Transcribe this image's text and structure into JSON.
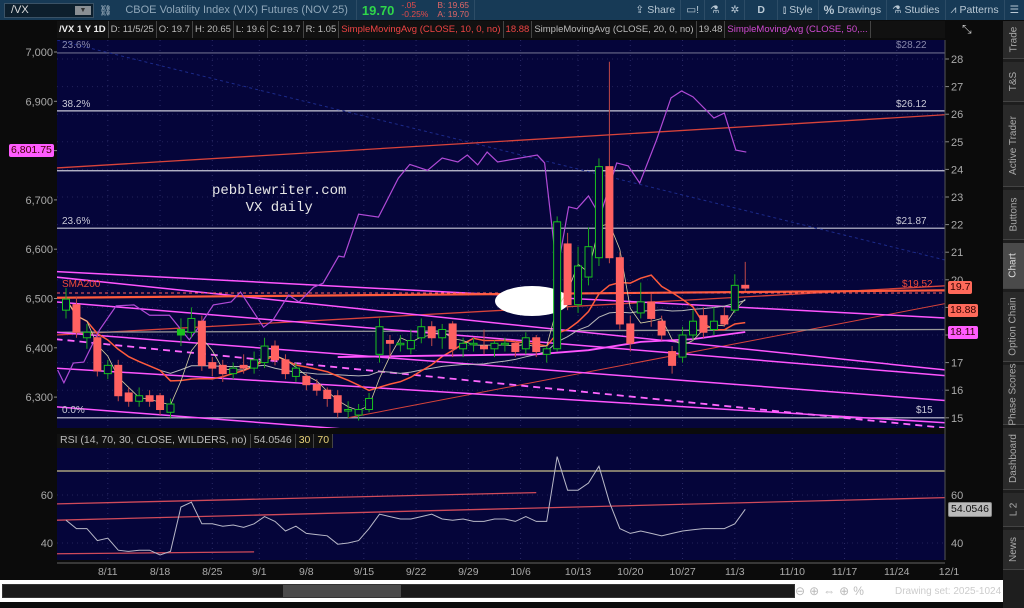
{
  "toolbar": {
    "symbol": "/VX",
    "description": "CBOE Volatility Index (VIX) Futures (NOV 25)",
    "last": "19.70",
    "change": "-.05",
    "change_pct": "-0.25%",
    "bid": "B: 19.65",
    "ask": "A: 19.70",
    "share": "Share",
    "timeframe": "D",
    "style": "Style",
    "drawings": "Drawings",
    "studies": "Studies",
    "patterns": "Patterns"
  },
  "header": {
    "symbol": "/VX 1 Y 1D",
    "date": "D: 11/5/25",
    "open": "O: 19.7",
    "high": "H: 20.65",
    "low": "L: 19.6",
    "close": "C: 19.7",
    "range": "R: 1.05",
    "sma10_label": "SimpleMovingAvg (CLOSE, 10, 0, no)",
    "sma10_value": "18.88",
    "sma20_label": "SimpleMovingAvg (CLOSE, 20, 0, no)",
    "sma20_value": "19.48",
    "sma50_label": "SimpleMovingAvg (CLOSE, 50,..."
  },
  "side_tabs": [
    "Trade",
    "T&S",
    "Active Trader",
    "Buttons",
    "Chart",
    "Option Chain",
    "Phase Scores",
    "Dashboard",
    "L 2",
    "News"
  ],
  "watermark": {
    "line1": "pebblewriter.com",
    "line2": "VX daily"
  },
  "annotations": {
    "fib_top_pct": "23.6%",
    "fib_top_price": "$28.22",
    "fib_382_pct": "38.2%",
    "fib_382_price": "$26.12",
    "fib_236_pct": "23.6%",
    "fib_236_price": "$21.87",
    "fib_0_pct": "0.0%",
    "fib_0_price": "$15",
    "sma200_label": "SMA200",
    "sma200_price": "$19.52"
  },
  "price_tags": {
    "last": "19.7",
    "sma10": "18.88",
    "sma50": "18.11",
    "overlay": "6,801.75",
    "rsi": "54.0546"
  },
  "rsi_header": {
    "label": "RSI (14, 70, 30, CLOSE, WILDERS, no)",
    "value": "54.0546",
    "os": "30",
    "ob": "70"
  },
  "bottom": {
    "drawing_set": "Drawing set: 2025-1024"
  },
  "colors": {
    "up": "#19c21f",
    "down": "#ff6161",
    "sma10": "#ff5a3c",
    "sma20": "#b8b8b8",
    "sma50": "#ff55ff",
    "overlay": "#b04ad6",
    "bg": "#05053a"
  },
  "chart_data": {
    "type": "candlestick",
    "title": "/VX 1 Y 1D",
    "right_axis_ticks": [
      "15",
      "16",
      "17",
      "18",
      "19",
      "20",
      "21",
      "22",
      "23",
      "24",
      "25",
      "26",
      "27",
      "28"
    ],
    "left_axis_ticks": [
      "6,300",
      "6,400",
      "6,500",
      "6,600",
      "6,700",
      "6,800",
      "6,900",
      "7,000"
    ],
    "rsi_ticks": [
      "40",
      "60"
    ],
    "x_labels": [
      {
        "label": "8/11",
        "day": 4
      },
      {
        "label": "8/18",
        "day": 9
      },
      {
        "label": "8/25",
        "day": 14
      },
      {
        "label": "9/1",
        "day": 18.5
      },
      {
        "label": "9/8",
        "day": 23
      },
      {
        "label": "9/15",
        "day": 28.5
      },
      {
        "label": "9/22",
        "day": 33.5
      },
      {
        "label": "9/29",
        "day": 38.5
      },
      {
        "label": "10/6",
        "day": 43.5
      },
      {
        "label": "10/13",
        "day": 49
      },
      {
        "label": "10/20",
        "day": 54
      },
      {
        "label": "10/27",
        "day": 59
      },
      {
        "label": "11/3",
        "day": 64
      },
      {
        "label": "11/10",
        "day": 69.5
      },
      {
        "label": "11/17",
        "day": 74.5
      },
      {
        "label": "11/24",
        "day": 79.5
      },
      {
        "label": "12/1",
        "day": 84.5
      }
    ],
    "ohlc": [
      [
        18.9,
        19.7,
        18.6,
        19.3
      ],
      [
        19.1,
        19.4,
        17.9,
        18.1
      ],
      [
        17.9,
        18.4,
        17.5,
        18.1
      ],
      [
        17.9,
        18.0,
        16.5,
        16.7
      ],
      [
        16.6,
        17.1,
        16.4,
        16.9
      ],
      [
        16.9,
        17.1,
        15.6,
        15.8
      ],
      [
        15.9,
        16.1,
        15.4,
        15.6
      ],
      [
        15.6,
        16.1,
        15.4,
        15.8
      ],
      [
        15.8,
        16.0,
        15.4,
        15.6
      ],
      [
        15.8,
        15.9,
        15.1,
        15.3
      ],
      [
        15.2,
        15.7,
        15.0,
        15.5
      ],
      [
        18.0,
        18.6,
        17.6,
        18.2
      ],
      [
        18.1,
        19.0,
        17.9,
        18.6
      ],
      [
        18.5,
        18.7,
        16.7,
        16.9
      ],
      [
        17.0,
        17.2,
        16.5,
        16.8
      ],
      [
        16.9,
        17.1,
        16.3,
        16.6
      ],
      [
        16.6,
        17.0,
        16.4,
        16.8
      ],
      [
        16.9,
        17.3,
        16.6,
        16.8
      ],
      [
        16.8,
        17.4,
        16.6,
        17.1
      ],
      [
        17.0,
        17.9,
        16.8,
        17.6
      ],
      [
        17.6,
        17.8,
        16.9,
        17.1
      ],
      [
        17.1,
        17.3,
        16.4,
        16.6
      ],
      [
        16.5,
        17.0,
        16.3,
        16.8
      ],
      [
        16.5,
        16.6,
        16.0,
        16.2
      ],
      [
        16.2,
        16.4,
        15.8,
        16.0
      ],
      [
        16.0,
        16.1,
        15.4,
        15.7
      ],
      [
        15.8,
        16.0,
        15.0,
        15.2
      ],
      [
        15.3,
        15.6,
        15.0,
        15.3
      ],
      [
        15.1,
        15.5,
        14.9,
        15.3
      ],
      [
        15.3,
        15.9,
        15.2,
        15.7
      ],
      [
        17.3,
        18.6,
        17.0,
        18.3
      ],
      [
        17.8,
        18.0,
        17.2,
        17.7
      ],
      [
        17.7,
        18.0,
        17.4,
        17.7
      ],
      [
        17.5,
        18.2,
        17.3,
        17.8
      ],
      [
        17.9,
        18.6,
        17.7,
        18.3
      ],
      [
        18.3,
        18.5,
        17.6,
        17.9
      ],
      [
        17.9,
        18.4,
        17.5,
        18.2
      ],
      [
        18.4,
        18.5,
        17.2,
        17.5
      ],
      [
        17.5,
        17.9,
        17.2,
        17.7
      ],
      [
        17.7,
        17.9,
        17.4,
        17.7
      ],
      [
        17.6,
        18.2,
        17.3,
        17.5
      ],
      [
        17.5,
        17.8,
        17.2,
        17.7
      ],
      [
        17.7,
        17.9,
        17.4,
        17.7
      ],
      [
        17.7,
        17.8,
        17.2,
        17.4
      ],
      [
        17.5,
        18.1,
        17.3,
        17.9
      ],
      [
        17.9,
        18.0,
        17.2,
        17.4
      ],
      [
        17.3,
        17.6,
        17.0,
        17.5
      ],
      [
        17.5,
        22.3,
        17.4,
        22.1
      ],
      [
        21.3,
        21.7,
        18.9,
        19.1
      ],
      [
        19.1,
        21.2,
        18.8,
        20.5
      ],
      [
        20.1,
        21.9,
        19.8,
        21.2
      ],
      [
        20.8,
        24.4,
        20.5,
        24.1
      ],
      [
        24.1,
        27.9,
        20.6,
        20.8
      ],
      [
        20.8,
        21.0,
        18.2,
        18.4
      ],
      [
        18.4,
        18.7,
        17.4,
        17.7
      ],
      [
        18.8,
        19.9,
        18.6,
        19.2
      ],
      [
        19.2,
        19.5,
        18.3,
        18.6
      ],
      [
        18.5,
        18.7,
        17.8,
        18.0
      ],
      [
        17.4,
        17.6,
        16.6,
        16.9
      ],
      [
        17.2,
        18.3,
        17.0,
        18.0
      ],
      [
        18.0,
        18.9,
        17.8,
        18.5
      ],
      [
        18.7,
        19.0,
        17.9,
        18.1
      ],
      [
        18.2,
        19.0,
        18.0,
        18.5
      ],
      [
        18.7,
        19.0,
        18.3,
        18.4
      ],
      [
        18.9,
        20.2,
        18.8,
        19.8
      ],
      [
        19.8,
        20.65,
        19.6,
        19.7
      ]
    ],
    "sma50": [
      [
        26,
        17.2
      ],
      [
        35,
        17.25
      ],
      [
        45,
        17.3
      ],
      [
        50,
        17.45
      ],
      [
        55,
        17.75
      ],
      [
        60,
        17.85
      ],
      [
        65,
        18.11
      ]
    ],
    "sma200": [
      [
        -1,
        19.35
      ],
      [
        85,
        19.62
      ]
    ],
    "overlay_spx": [
      [
        -0.8,
        6355
      ],
      [
        -0.2,
        6329
      ],
      [
        0.7,
        6369
      ],
      [
        1.7,
        6371
      ],
      [
        3.2,
        6436
      ],
      [
        4.8,
        6485
      ],
      [
        6.5,
        6487
      ],
      [
        8,
        6466
      ],
      [
        9.9,
        6466
      ],
      [
        11.8,
        6416
      ],
      [
        12.7,
        6442
      ],
      [
        14.1,
        6487
      ],
      [
        15.8,
        6493
      ],
      [
        16.7,
        6513
      ],
      [
        18,
        6471
      ],
      [
        18.9,
        6442
      ],
      [
        19.8,
        6456
      ],
      [
        21.3,
        6507
      ],
      [
        22.3,
        6493
      ],
      [
        23.7,
        6523
      ],
      [
        24.6,
        6531
      ],
      [
        26.1,
        6586
      ],
      [
        26.6,
        6584
      ],
      [
        28,
        6671
      ],
      [
        29.9,
        6665
      ],
      [
        31.8,
        6744
      ],
      [
        32.9,
        6772
      ],
      [
        34.6,
        6760
      ],
      [
        36,
        6785
      ],
      [
        37.5,
        6777
      ],
      [
        38.4,
        6791
      ],
      [
        39.4,
        6771
      ],
      [
        40.3,
        6797
      ],
      [
        41.3,
        6777
      ],
      [
        45.1,
        6791
      ],
      [
        45.8,
        6775
      ],
      [
        47,
        6554
      ],
      [
        48.1,
        6686
      ],
      [
        48.9,
        6682
      ],
      [
        50,
        6708
      ],
      [
        51.1,
        6667
      ],
      [
        52.7,
        6775
      ],
      [
        53.8,
        6769
      ],
      [
        54.9,
        6734
      ],
      [
        56.5,
        6821
      ],
      [
        57.9,
        6907
      ],
      [
        58.9,
        6921
      ],
      [
        60,
        6909
      ],
      [
        62,
        6866
      ],
      [
        63,
        6876
      ],
      [
        64.1,
        6801
      ],
      [
        65.1,
        6797
      ]
    ],
    "horizontal_levels": [
      28.22,
      26.12,
      23.95,
      21.87,
      15
    ],
    "trendlines": [
      {
        "kind": "red",
        "p": [
          [
            -1,
            24.05
          ],
          [
            85,
            26.0
          ]
        ]
      },
      {
        "kind": "red",
        "p": [
          [
            -1,
            18.0
          ],
          [
            85,
            19.8
          ]
        ]
      },
      {
        "kind": "redthin",
        "p": [
          [
            27,
            15.0
          ],
          [
            85,
            19.2
          ]
        ]
      },
      {
        "kind": "gray",
        "p": [
          [
            -1,
            18.1
          ],
          [
            85,
            18.2
          ]
        ]
      },
      {
        "kind": "magenta",
        "p": [
          [
            -1,
            20.3
          ],
          [
            85,
            18.6
          ]
        ]
      },
      {
        "kind": "magenta",
        "p": [
          [
            -1,
            20.1
          ],
          [
            85,
            16.7
          ]
        ]
      },
      {
        "kind": "magenta",
        "p": [
          [
            -1,
            19.2
          ],
          [
            85,
            16.5
          ]
        ]
      },
      {
        "kind": "magenta",
        "p": [
          [
            -1,
            18.1
          ],
          [
            85,
            15.6
          ]
        ]
      },
      {
        "kind": "magenta",
        "p": [
          [
            -1,
            16.8
          ],
          [
            85,
            14.8
          ]
        ]
      },
      {
        "kind": "magenta",
        "p": [
          [
            -1,
            15.4
          ],
          [
            40,
            14.2
          ]
        ]
      },
      {
        "kind": "dashed",
        "p": [
          [
            -1,
            17.85
          ],
          [
            85,
            14.6
          ]
        ]
      }
    ],
    "rsi": [
      49.5,
      46,
      46,
      41,
      42,
      37,
      36.5,
      37,
      37,
      35,
      36.5,
      55,
      57,
      48,
      48,
      47,
      47.5,
      46.5,
      48,
      51,
      49,
      45,
      47,
      44,
      43.5,
      43,
      39.5,
      40,
      41,
      46,
      52,
      51,
      50,
      50,
      51,
      52,
      50,
      49.5,
      50,
      49,
      49,
      50,
      50,
      49,
      51,
      49,
      49,
      76,
      62,
      62,
      65,
      72,
      57,
      46,
      44,
      45,
      44,
      43,
      44,
      45,
      45.5,
      46,
      46,
      46,
      48,
      54.05
    ],
    "rsi_levels": [
      70
    ],
    "rsi_trendlines": [
      [
        [
          -1,
          56.3
        ],
        [
          45,
          61
        ]
      ],
      [
        [
          -1,
          49.5
        ],
        [
          85,
          59
        ]
      ],
      [
        [
          -1,
          35.5
        ],
        [
          18,
          36.3
        ]
      ]
    ]
  }
}
